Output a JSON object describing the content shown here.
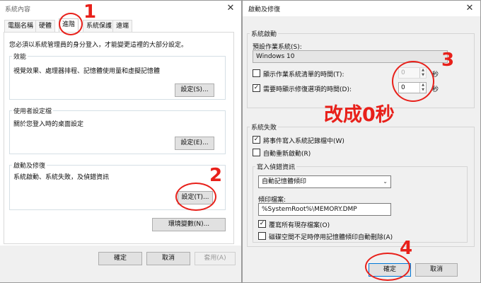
{
  "left_window": {
    "title": "系統內容",
    "tabs": [
      "電腦名稱",
      "硬體",
      "進階",
      "系統保護",
      "遠端"
    ],
    "intro": "您必須以系統管理員的身分登入，才能變更這裡的大部分設定。",
    "performance": {
      "label": "效能",
      "desc": "視覺效果、處理器排程、記憶體使用量和虛擬記憶體",
      "button": "設定(S)..."
    },
    "profiles": {
      "label": "使用者設定檔",
      "desc": "關於您登入時的桌面設定",
      "button": "設定(E)..."
    },
    "startup": {
      "label": "啟動及修復",
      "desc": "系統啟動、系統失敗，及偵錯資訊",
      "button": "設定(T)..."
    },
    "env_button": "環境變數(N)...",
    "ok": "確定",
    "cancel": "取消",
    "apply": "套用(A)"
  },
  "right_window": {
    "title": "啟動及修復",
    "startup_group": "系統啟動",
    "default_os_label": "預設作業系統(S):",
    "default_os_value": "Windows 10",
    "show_list_label": "顯示作業系統清單的時間(T):",
    "show_list_checked": false,
    "show_list_value": "0",
    "show_recovery_label": "需要時顯示修復選項的時間(D):",
    "show_recovery_checked": true,
    "show_recovery_value": "0",
    "seconds": "秒",
    "failure_group": "系統失敗",
    "write_event_label": "將事件寫入系統記錄檔中(W)",
    "write_event_checked": true,
    "auto_restart_label": "自動重新啟動(R)",
    "auto_restart_checked": false,
    "debug_group": "寫入偵錯資訊",
    "debug_select": "自動記憶體傾印",
    "dump_file_label": "傾印檔案:",
    "dump_file_value": "%SystemRoot%\\MEMORY.DMP",
    "overwrite_label": "覆寫所有現存檔案(O)",
    "overwrite_checked": true,
    "disable_auto_delete_label": "磁碟空間不足時停用記憶體傾印自動刪除(A)",
    "disable_auto_delete_checked": false,
    "ok": "確定",
    "cancel": "取消"
  },
  "annotations": {
    "n1": "1",
    "n2": "2",
    "n3": "3",
    "n4": "4",
    "note": "改成0秒",
    "color": "#e8201a"
  }
}
